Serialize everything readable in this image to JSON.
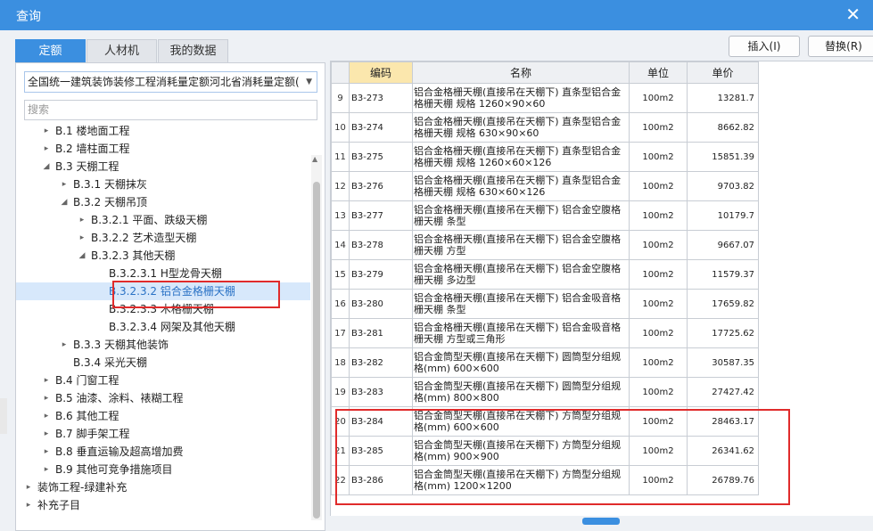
{
  "window": {
    "title": "查询",
    "close_icon": "close-icon"
  },
  "tabs": [
    {
      "label": "定额",
      "active": true
    },
    {
      "label": "人材机",
      "active": false
    },
    {
      "label": "我的数据",
      "active": false
    }
  ],
  "buttons": {
    "insert": "插入(I)",
    "replace": "替换(R)"
  },
  "left": {
    "select_value": "全国统一建筑装饰装修工程消耗量定额河北省消耗量定额(20",
    "search_placeholder": "搜索",
    "tree": [
      {
        "label": "B.1 楼地面工程",
        "arrow": "▸"
      },
      {
        "label": "B.2 墙柱面工程",
        "arrow": "▸"
      },
      {
        "label": "B.3 天棚工程",
        "arrow": "◢"
      },
      {
        "label": "B.3.1 天棚抹灰",
        "arrow": "▸"
      },
      {
        "label": "B.3.2 天棚吊顶",
        "arrow": "◢"
      },
      {
        "label": "B.3.2.1 平面、跌级天棚",
        "arrow": "▸"
      },
      {
        "label": "B.3.2.2 艺术造型天棚",
        "arrow": "▸"
      },
      {
        "label": "B.3.2.3 其他天棚",
        "arrow": "◢"
      },
      {
        "label": "B.3.2.3.1 H型龙骨天棚",
        "arrow": ""
      },
      {
        "label": "B.3.2.3.2 铝合金格栅天棚",
        "arrow": "",
        "selected": true
      },
      {
        "label": "B.3.2.3.3 木格栅天棚",
        "arrow": ""
      },
      {
        "label": "B.3.2.3.4 网架及其他天棚",
        "arrow": ""
      },
      {
        "label": "B.3.3 天棚其他装饰",
        "arrow": "▸"
      },
      {
        "label": "B.3.4 采光天棚",
        "arrow": ""
      },
      {
        "label": "B.4 门窗工程",
        "arrow": "▸"
      },
      {
        "label": "B.5 油漆、涂料、裱糊工程",
        "arrow": "▸"
      },
      {
        "label": "B.6 其他工程",
        "arrow": "▸"
      },
      {
        "label": "B.7 脚手架工程",
        "arrow": "▸"
      },
      {
        "label": "B.8 垂直运输及超高增加费",
        "arrow": "▸"
      },
      {
        "label": "B.9 其他可竞争措施项目",
        "arrow": "▸"
      },
      {
        "label": "装饰工程-绿建补充",
        "arrow": "▸"
      },
      {
        "label": "补充子目",
        "arrow": "▸"
      }
    ]
  },
  "table": {
    "headers": {
      "code": "编码",
      "name": "名称",
      "unit": "单位",
      "price": "单价"
    },
    "rows": [
      {
        "idx": "9",
        "code": "B3-273",
        "name": "铝合金格栅天棚(直接吊在天棚下) 直条型铝合金格栅天棚 规格 1260×90×60",
        "unit": "100m2",
        "price": "13281.7"
      },
      {
        "idx": "10",
        "code": "B3-274",
        "name": "铝合金格栅天棚(直接吊在天棚下) 直条型铝合金格栅天棚 规格 630×90×60",
        "unit": "100m2",
        "price": "8662.82"
      },
      {
        "idx": "11",
        "code": "B3-275",
        "name": "铝合金格栅天棚(直接吊在天棚下) 直条型铝合金格栅天棚 规格 1260×60×126",
        "unit": "100m2",
        "price": "15851.39"
      },
      {
        "idx": "12",
        "code": "B3-276",
        "name": "铝合金格栅天棚(直接吊在天棚下) 直条型铝合金格栅天棚 规格 630×60×126",
        "unit": "100m2",
        "price": "9703.82"
      },
      {
        "idx": "13",
        "code": "B3-277",
        "name": "铝合金格栅天棚(直接吊在天棚下) 铝合金空腹格栅天棚 条型",
        "unit": "100m2",
        "price": "10179.7"
      },
      {
        "idx": "14",
        "code": "B3-278",
        "name": "铝合金格栅天棚(直接吊在天棚下) 铝合金空腹格栅天棚 方型",
        "unit": "100m2",
        "price": "9667.07"
      },
      {
        "idx": "15",
        "code": "B3-279",
        "name": "铝合金格栅天棚(直接吊在天棚下) 铝合金空腹格栅天棚 多边型",
        "unit": "100m2",
        "price": "11579.37"
      },
      {
        "idx": "16",
        "code": "B3-280",
        "name": "铝合金格栅天棚(直接吊在天棚下) 铝合金吸音格栅天棚 条型",
        "unit": "100m2",
        "price": "17659.82"
      },
      {
        "idx": "17",
        "code": "B3-281",
        "name": "铝合金格栅天棚(直接吊在天棚下) 铝合金吸音格栅天棚 方型或三角形",
        "unit": "100m2",
        "price": "17725.62"
      },
      {
        "idx": "18",
        "code": "B3-282",
        "name": "铝合金筒型天棚(直接吊在天棚下) 圆筒型分组规格(mm) 600×600",
        "unit": "100m2",
        "price": "30587.35"
      },
      {
        "idx": "19",
        "code": "B3-283",
        "name": "铝合金筒型天棚(直接吊在天棚下) 圆筒型分组规格(mm) 800×800",
        "unit": "100m2",
        "price": "27427.42"
      },
      {
        "idx": "20",
        "code": "B3-284",
        "name": "铝合金筒型天棚(直接吊在天棚下) 方筒型分组规格(mm) 600×600",
        "unit": "100m2",
        "price": "28463.17"
      },
      {
        "idx": "21",
        "code": "B3-285",
        "name": "铝合金筒型天棚(直接吊在天棚下) 方筒型分组规格(mm) 900×900",
        "unit": "100m2",
        "price": "26341.62"
      },
      {
        "idx": "22",
        "code": "B3-286",
        "name": "铝合金筒型天棚(直接吊在天棚下) 方筒型分组规格(mm) 1200×1200",
        "unit": "100m2",
        "price": "26789.76"
      }
    ]
  },
  "colors": {
    "accent": "#3b8fe0",
    "highlight_box": "#e02b2b",
    "code_header": "#fbe7ad",
    "selected_row": "#d7e8fb"
  }
}
